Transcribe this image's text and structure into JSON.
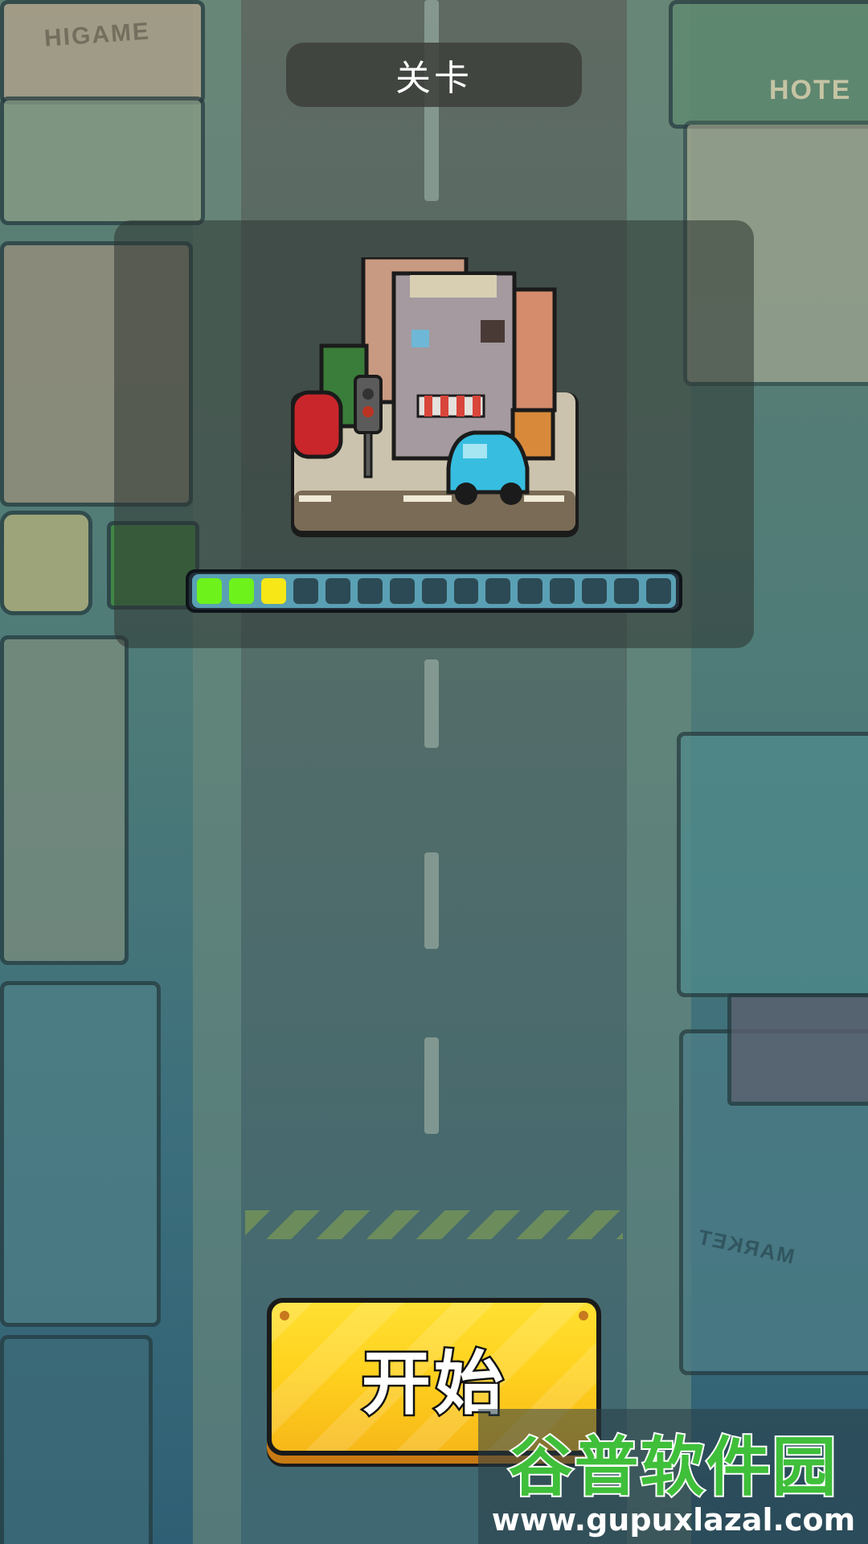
{
  "level": {
    "title": "关卡",
    "progress": {
      "total": 15,
      "completed": 2,
      "current": 3
    }
  },
  "start_button": {
    "label": "开始"
  },
  "watermark": {
    "title": "谷普软件园",
    "url": "www.gupuxlazal.com"
  },
  "scenery_signs": {
    "shop": "HIGAME",
    "hotel": "HOTE",
    "market": "MARKET"
  },
  "colors": {
    "progress_done": "#6ef21c",
    "progress_current": "#f7e717",
    "button": "#ffd21e"
  }
}
